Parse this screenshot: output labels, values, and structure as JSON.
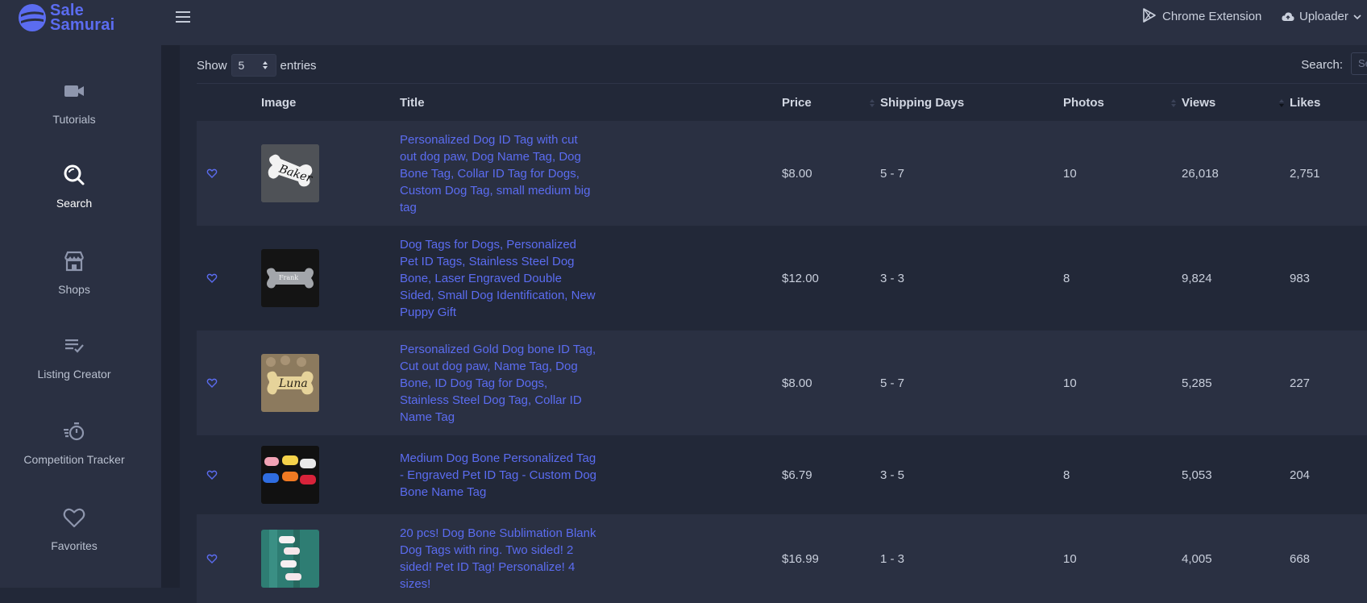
{
  "app": {
    "logo_line1": "Sale",
    "logo_line2": "Samurai"
  },
  "header": {
    "chrome_extension": "Chrome Extension",
    "uploader": "Uploader"
  },
  "sidebar": {
    "items": [
      {
        "label": "Tutorials",
        "icon": "video-camera-icon"
      },
      {
        "label": "Search",
        "icon": "search-icon",
        "active": true
      },
      {
        "label": "Shops",
        "icon": "store-icon"
      },
      {
        "label": "Listing Creator",
        "icon": "list-check-icon"
      },
      {
        "label": "Competition Tracker",
        "icon": "stopwatch-icon"
      },
      {
        "label": "Favorites",
        "icon": "heart-icon"
      }
    ]
  },
  "table": {
    "show_label": "Show",
    "entries_value": "5",
    "entries_label": "entries",
    "search_label": "Search:",
    "search_placeholder": "Se",
    "columns": [
      "Image",
      "Title",
      "Price",
      "Shipping Days",
      "Photos",
      "Views",
      "Likes"
    ],
    "rows": [
      {
        "title": "Personalized Dog ID Tag with cut out dog paw, Dog Name Tag, Dog Bone Tag, Collar ID Tag for Dogs, Custom Dog Tag, small medium big tag",
        "price": "$8.00",
        "shipping": "5 - 7",
        "photos": "10",
        "views": "26,018",
        "likes": "2,751",
        "image_text": "Baker"
      },
      {
        "title": "Dog Tags for Dogs, Personalized Pet ID Tags, Stainless Steel Dog Bone, Laser Engraved Double Sided, Small Dog Identification, New Puppy Gift",
        "price": "$12.00",
        "shipping": "3 - 3",
        "photos": "8",
        "views": "9,824",
        "likes": "983",
        "image_text": "Frank"
      },
      {
        "title": "Personalized Gold Dog bone ID Tag, Cut out dog paw, Name Tag, Dog Bone, ID Dog Tag for Dogs, Stainless Steel Dog Tag, Collar ID Name Tag",
        "price": "$8.00",
        "shipping": "5 - 7",
        "photos": "10",
        "views": "5,285",
        "likes": "227",
        "image_text": "Luna"
      },
      {
        "title": "Medium Dog Bone Personalized Tag - Engraved Pet ID Tag - Custom Dog Bone Name Tag",
        "price": "$6.79",
        "shipping": "3 - 5",
        "photos": "8",
        "views": "5,053",
        "likes": "204",
        "image_text": ""
      },
      {
        "title": "20 pcs! Dog Bone Sublimation Blank Dog Tags with ring. Two sided! 2 sided! Pet ID Tag! Personalize! 4 sizes!",
        "price": "$16.99",
        "shipping": "1 - 3",
        "photos": "10",
        "views": "4,005",
        "likes": "668",
        "image_text": ""
      }
    ]
  },
  "colors": {
    "accent": "#5b6cf0",
    "sidebar_bg": "#2a3042",
    "page_bg": "#222838"
  }
}
